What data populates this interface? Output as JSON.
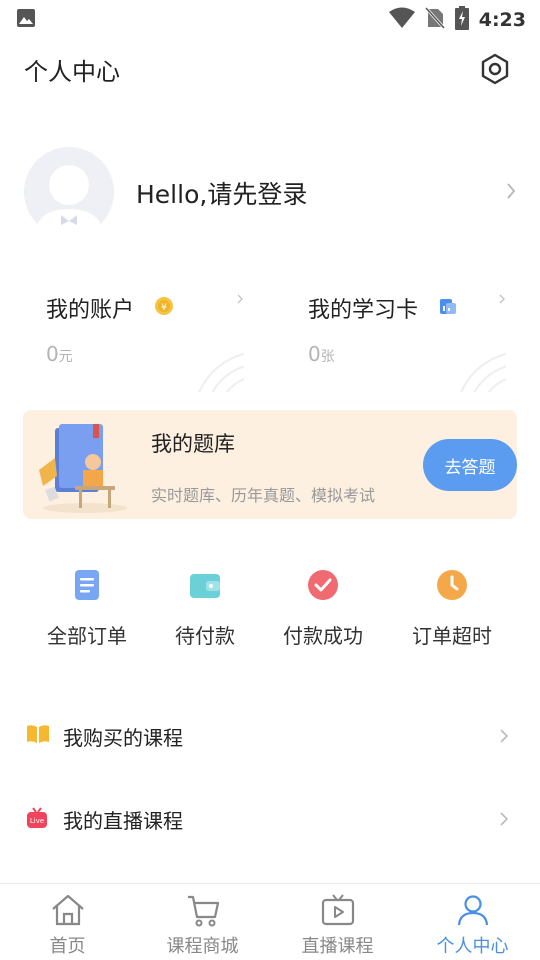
{
  "status_bar": {
    "time": "4:23"
  },
  "header": {
    "title": "个人中心",
    "settings_icon": "gear-icon"
  },
  "profile": {
    "login_prompt": "Hello,请先登录"
  },
  "account_card": {
    "title": "我的账户",
    "value": "0",
    "unit": "元"
  },
  "study_card": {
    "title": "我的学习卡",
    "value": "0",
    "unit": "张"
  },
  "question_bank": {
    "title": "我的题库",
    "subtitle": "实时题库、历年真题、模拟考试",
    "button": "去答题"
  },
  "orders": [
    {
      "label": "全部订单",
      "icon": "document-icon"
    },
    {
      "label": "待付款",
      "icon": "wallet-icon"
    },
    {
      "label": "付款成功",
      "icon": "check-icon"
    },
    {
      "label": "订单超时",
      "icon": "clock-icon"
    }
  ],
  "menu": [
    {
      "label": "我购买的课程",
      "icon": "book-icon"
    },
    {
      "label": "我的直播课程",
      "icon": "live-icon",
      "badge": "Live"
    }
  ],
  "bottom_nav": [
    {
      "label": "首页",
      "icon": "home-icon",
      "active": false
    },
    {
      "label": "课程商城",
      "icon": "cart-icon",
      "active": false
    },
    {
      "label": "直播课程",
      "icon": "tv-icon",
      "active": false
    },
    {
      "label": "个人中心",
      "icon": "user-icon",
      "active": true
    }
  ],
  "colors": {
    "accent": "#4a90e2",
    "banner_bg": "#fdf0e1",
    "button": "#5b9cf0"
  }
}
